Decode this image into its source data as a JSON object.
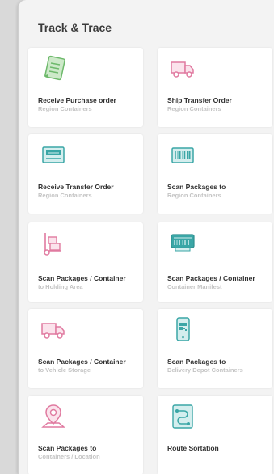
{
  "page": {
    "title": "Track & Trace"
  },
  "tiles": [
    {
      "label": "Receive Purchase order",
      "sub": "Region Containers",
      "icon": "receipt-icon"
    },
    {
      "label": "Ship Transfer Order",
      "sub": "Region Containers",
      "icon": "delivery-truck-icon"
    },
    {
      "label": "Receive Transfer Order",
      "sub": "Region Containers",
      "icon": "scanner-screen-icon"
    },
    {
      "label": "Scan Packages to",
      "sub": "Region Containers",
      "icon": "barcode-icon"
    },
    {
      "label": "Scan Packages / Container",
      "sub": "to Holding Area",
      "icon": "hand-truck-icon"
    },
    {
      "label": "Scan Packages / Container",
      "sub": "Container Manifest",
      "icon": "barcode-scanner-icon"
    },
    {
      "label": "Scan Packages / Container",
      "sub": "to Vehicle Storage",
      "icon": "delivery-truck-icon"
    },
    {
      "label": "Scan Packages to",
      "sub": "Delivery Depot Containers",
      "icon": "phone-qr-icon"
    },
    {
      "label": "Scan Packages to",
      "sub": "Containers / Location",
      "icon": "map-pin-icon"
    },
    {
      "label": "Route Sortation",
      "sub": "",
      "icon": "route-icon"
    }
  ],
  "colors": {
    "green": "#7bc67a",
    "pink": "#e07aa0",
    "teal": "#3aa6a6",
    "background": "#f3f3f3",
    "tile": "#ffffff"
  }
}
